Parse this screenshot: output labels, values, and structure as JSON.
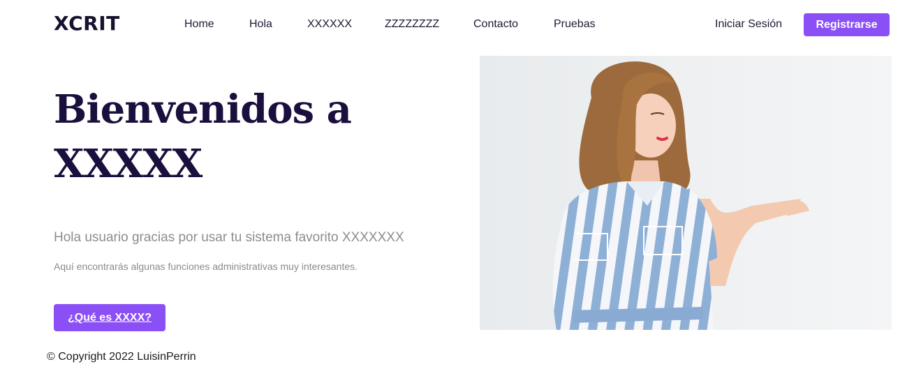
{
  "header": {
    "brand": "XCRIT",
    "nav": [
      {
        "label": "Home"
      },
      {
        "label": "Hola"
      },
      {
        "label": "XXXXXX"
      },
      {
        "label": "ZZZZZZZZ"
      },
      {
        "label": "Contacto"
      },
      {
        "label": "Pruebas"
      }
    ],
    "login_label": "Iniciar Sesión",
    "register_label": "Registrarse"
  },
  "hero": {
    "title_line1": "Bienvenidos a",
    "title_line2": "XXXXX",
    "subtitle": "Hola usuario gracias por usar tu sistema favorito XXXXXXX",
    "description": "Aquí encontrarás algunas funciones administrativas muy interesantes.",
    "cta_label": "¿Qué es XXXX?"
  },
  "footer": {
    "copyright": "© Copyright 2022 LuisinPerrin"
  },
  "colors": {
    "accent": "#8b50f5",
    "title": "#1a0f3d",
    "muted": "#8c8c8c"
  }
}
